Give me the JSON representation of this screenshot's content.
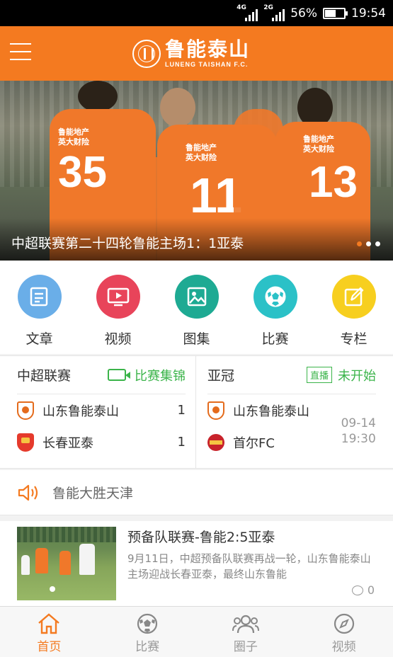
{
  "status_bar": {
    "network_1": "4G",
    "network_2": "2G",
    "battery": "56%",
    "battery_level": 0.56,
    "time": "19:54"
  },
  "header": {
    "brand_cn": "鲁能泰山",
    "brand_en": "LUNENG TAISHAN F.C."
  },
  "banner": {
    "caption": "中超联赛第二十四轮鲁能主场1：1亚泰",
    "jersey_numbers": [
      "35",
      "11",
      "13"
    ],
    "jersey_sponsor": "鲁能地产\n英大财险",
    "slides": 3,
    "active_slide": 0,
    "accent_color": "#f47a20"
  },
  "categories": [
    {
      "label": "文章",
      "icon": "article-icon",
      "color": "#6aaee8"
    },
    {
      "label": "视频",
      "icon": "video-icon",
      "color": "#e8445a"
    },
    {
      "label": "图集",
      "icon": "gallery-icon",
      "color": "#1eaa93"
    },
    {
      "label": "比赛",
      "icon": "soccer-ball-icon",
      "color": "#2bc1c7"
    },
    {
      "label": "专栏",
      "icon": "column-icon",
      "color": "#f7cf1f"
    }
  ],
  "matches": {
    "csl": {
      "title": "中超联赛",
      "link": "比赛集锦",
      "home": {
        "name": "山东鲁能泰山",
        "score": "1"
      },
      "away": {
        "name": "长春亚泰",
        "score": "1"
      }
    },
    "acl": {
      "title": "亚冠",
      "tag": "直播",
      "status": "未开始",
      "home": {
        "name": "山东鲁能泰山"
      },
      "away": {
        "name": "首尔FC"
      },
      "date": "09-14",
      "time": "19:30"
    }
  },
  "notice": {
    "text": "鲁能大胜天津"
  },
  "news": {
    "title": "预备队联赛-鲁能2:5亚泰",
    "summary": "9月11日，中超预备队联赛再战一轮，山东鲁能泰山主场迎战长春亚泰，最终山东鲁能",
    "comments": "0"
  },
  "tabbar": [
    {
      "label": "首页",
      "icon": "home-icon",
      "active": true
    },
    {
      "label": "比赛",
      "icon": "soccer-ball-icon",
      "active": false
    },
    {
      "label": "圈子",
      "icon": "community-icon",
      "active": false
    },
    {
      "label": "视频",
      "icon": "compass-icon",
      "active": false
    }
  ],
  "colors": {
    "brand": "#f47a20",
    "green": "#3bb44a"
  }
}
